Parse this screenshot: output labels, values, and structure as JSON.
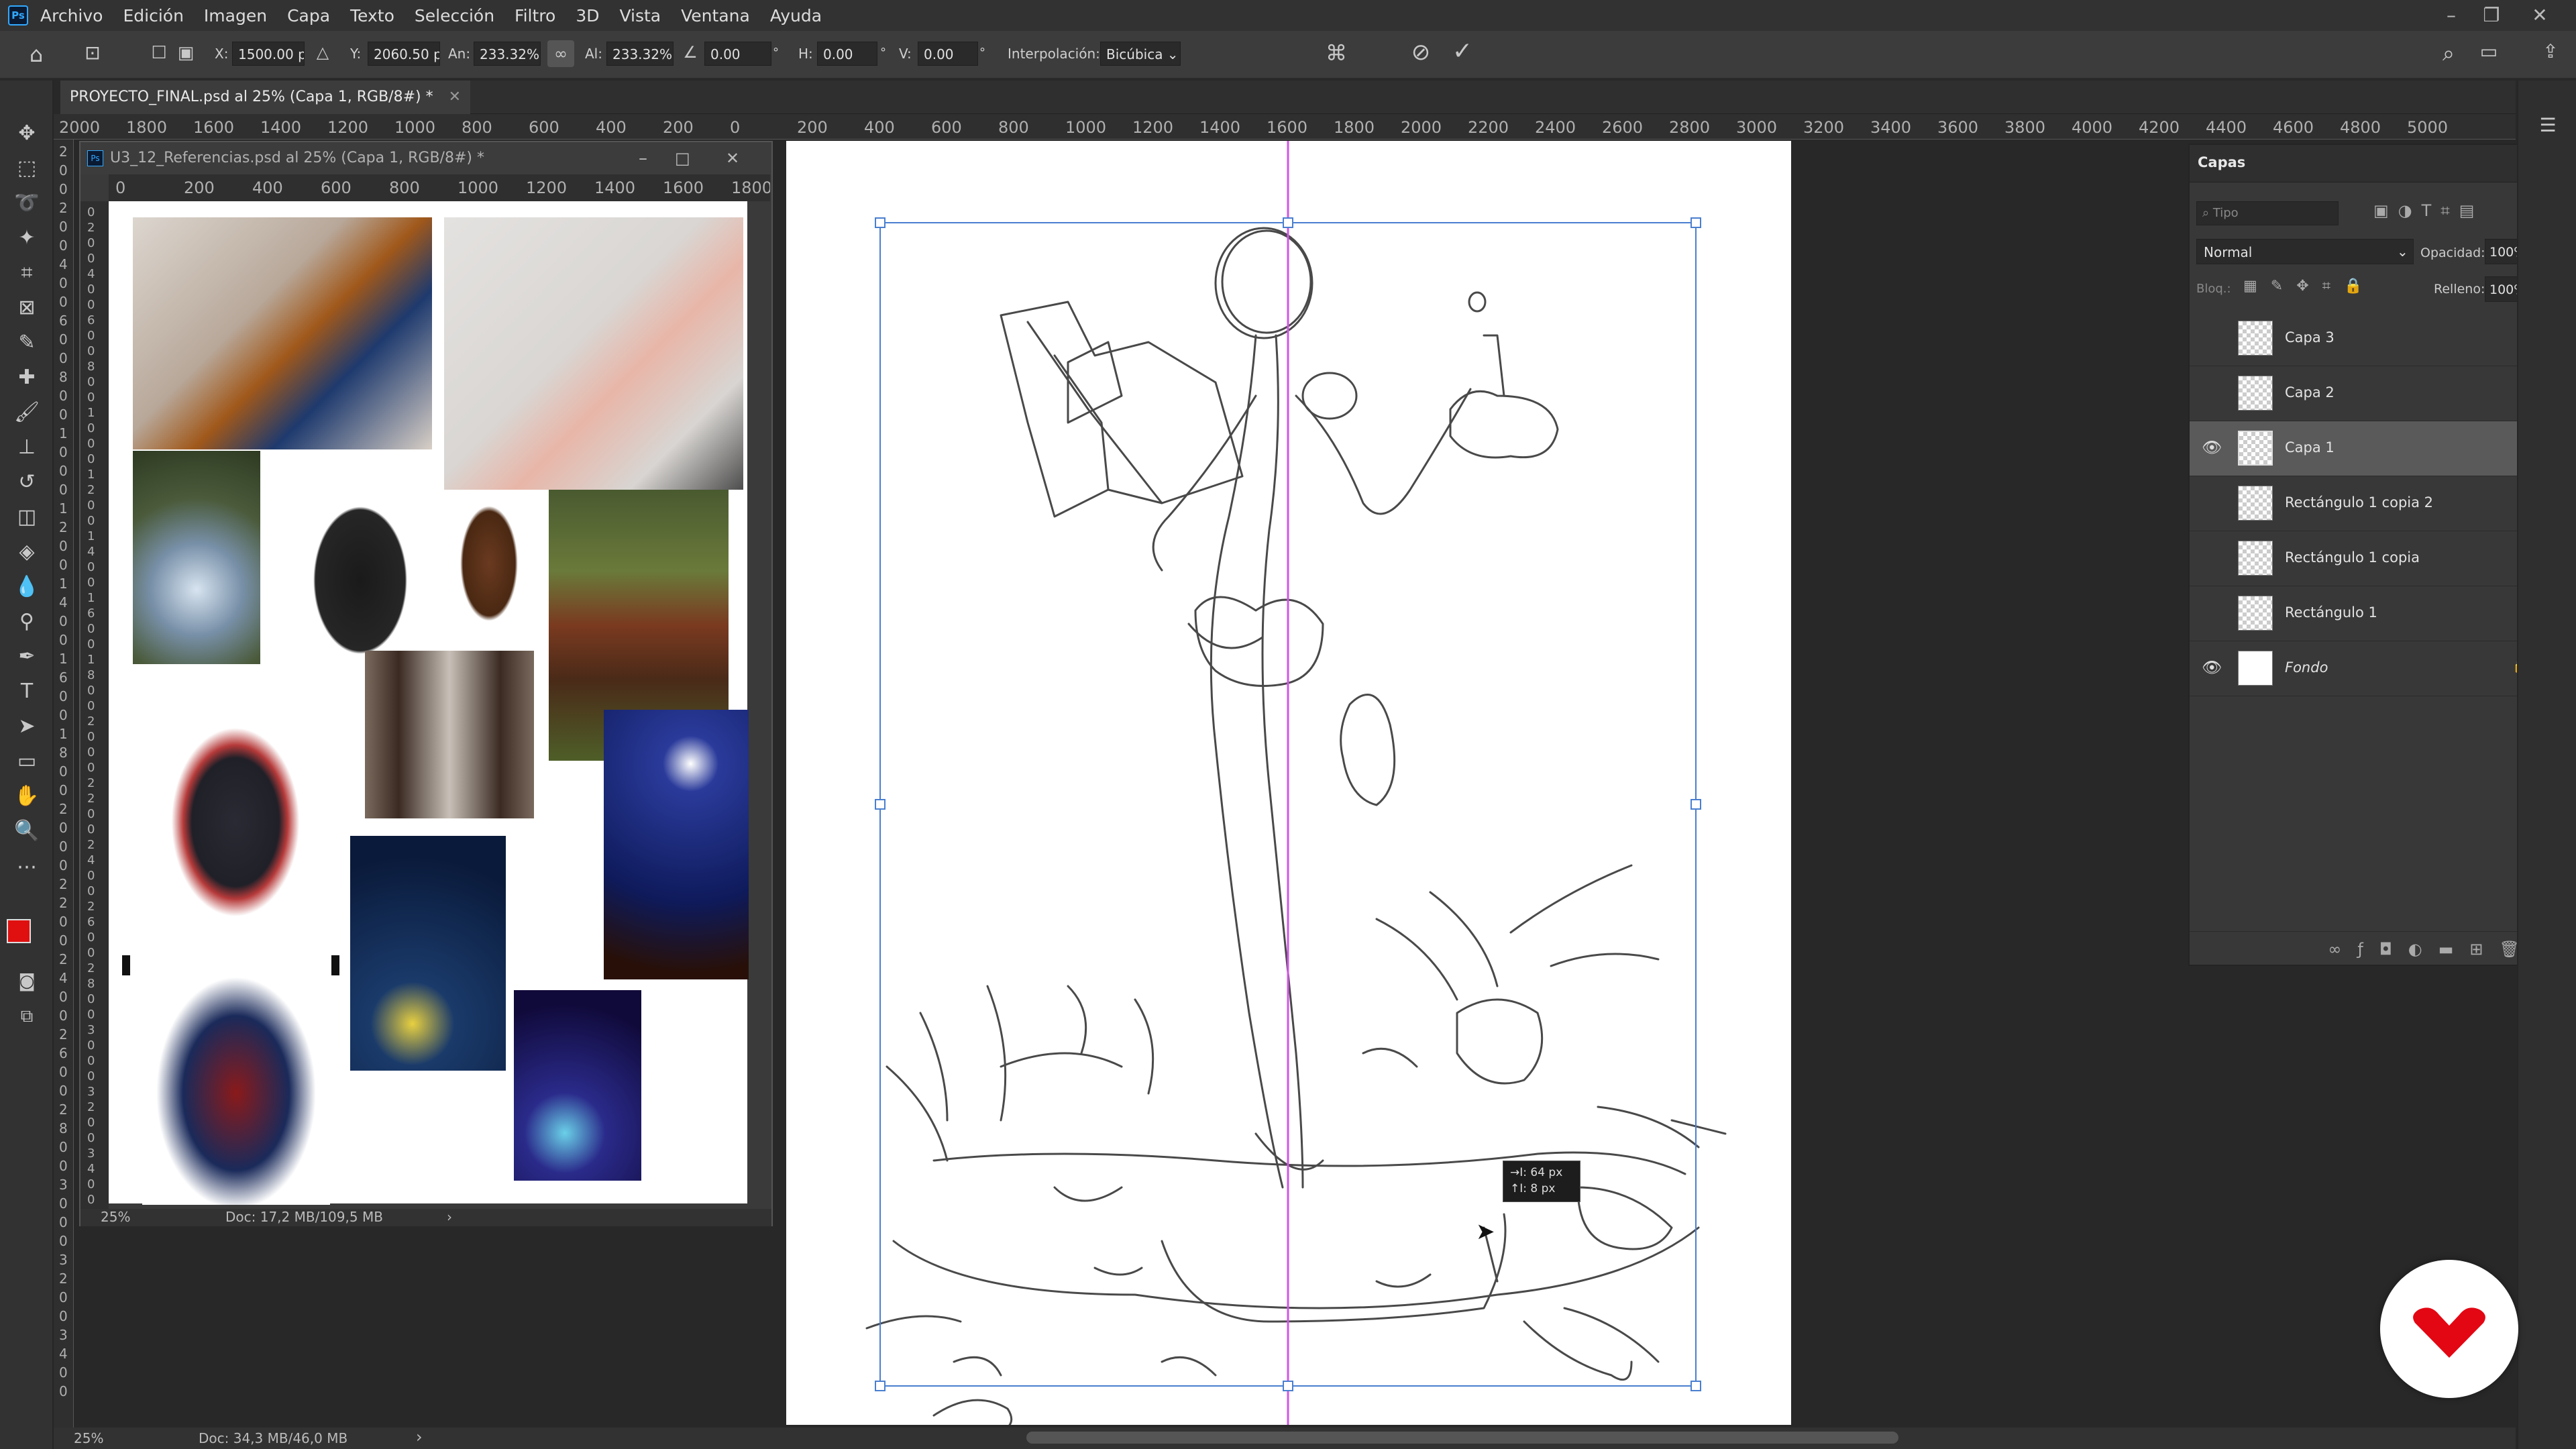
{
  "menu": {
    "app_icon": "Ps",
    "items": [
      "Archivo",
      "Edición",
      "Imagen",
      "Capa",
      "Texto",
      "Selección",
      "Filtro",
      "3D",
      "Vista",
      "Ventana",
      "Ayuda"
    ]
  },
  "options_bar": {
    "x_label": "X:",
    "x_value": "1500.00 p:",
    "y_label": "Y:",
    "y_value": "2060.50 p:",
    "w_label": "An:",
    "w_value": "233.32%",
    "h_label": "Al:",
    "h_value": "233.32%",
    "rotate_value": "0.00",
    "hskew_label": "H:",
    "hskew_value": "0.00",
    "vskew_label": "V:",
    "vskew_value": "0.00",
    "interp_label": "Interpolación:",
    "interp_value": "Bicúbica"
  },
  "document_tab": {
    "title": "PROYECTO_FINAL.psd al 25% (Capa 1, RGB/8#) *"
  },
  "ruler": {
    "h_labels": [
      "2000",
      "1800",
      "1600",
      "1400",
      "1200",
      "1000",
      "800",
      "600",
      "400",
      "200",
      "0",
      "200",
      "400",
      "600",
      "800",
      "1000",
      "1200",
      "1400",
      "1600",
      "1800",
      "2000",
      "2200",
      "2400",
      "2600",
      "2800",
      "3000",
      "3200",
      "3400",
      "3600",
      "3800",
      "4000",
      "4200",
      "4400",
      "4600",
      "4800",
      "5000"
    ],
    "v_labels": [
      "2",
      "0",
      "0",
      "2",
      "0",
      "0",
      "4",
      "0",
      "0",
      "6",
      "0",
      "0",
      "8",
      "0",
      "0",
      "1",
      "0",
      "0",
      "0",
      "1",
      "2",
      "0",
      "0",
      "1",
      "4",
      "0",
      "0",
      "1",
      "6",
      "0",
      "0",
      "1",
      "8",
      "0",
      "0",
      "2",
      "0",
      "0",
      "0",
      "2",
      "2",
      "0",
      "0",
      "2",
      "4",
      "0",
      "0",
      "2",
      "6",
      "0",
      "0",
      "2",
      "8",
      "0",
      "0",
      "3",
      "0",
      "0",
      "0",
      "3",
      "2",
      "0",
      "0",
      "3",
      "4",
      "0",
      "0"
    ]
  },
  "reference_window": {
    "title": "U3_12_Referencias.psd al 25% (Capa 1, RGB/8#) *",
    "ruler_labels": [
      "0",
      "200",
      "400",
      "600",
      "800",
      "1000",
      "1200",
      "1400",
      "1600",
      "1800"
    ],
    "vruler_labels": [
      "0",
      "2",
      "0",
      "0",
      "4",
      "0",
      "0",
      "6",
      "0",
      "0",
      "8",
      "0",
      "0",
      "1",
      "0",
      "0",
      "0",
      "1",
      "2",
      "0",
      "0",
      "1",
      "4",
      "0",
      "0",
      "1",
      "6",
      "0",
      "0",
      "1",
      "8",
      "0",
      "0",
      "2",
      "0",
      "0",
      "0",
      "2",
      "2",
      "0",
      "0",
      "2",
      "4",
      "0",
      "0",
      "2",
      "6",
      "0",
      "0",
      "2",
      "8",
      "0",
      "0",
      "3",
      "0",
      "0",
      "0",
      "3",
      "2",
      "0",
      "0",
      "3",
      "4",
      "0",
      "0"
    ],
    "zoom": "25%",
    "doc_size": "Doc: 17,2 MB/109,5 MB"
  },
  "layers_panel": {
    "tab": "Capas",
    "search_placeholder": "Tipo",
    "blend_mode": "Normal",
    "opacity_label": "Opacidad:",
    "opacity_value": "100%",
    "lock_label": "Bloq.:",
    "fill_label": "Relleno:",
    "fill_value": "100%",
    "layers": [
      {
        "name": "Capa 3",
        "visible": false
      },
      {
        "name": "Capa 2",
        "visible": false
      },
      {
        "name": "Capa 1",
        "visible": true,
        "selected": true
      },
      {
        "name": "Rectángulo 1 copia 2",
        "visible": false
      },
      {
        "name": "Rectángulo 1 copia",
        "visible": false
      },
      {
        "name": "Rectángulo 1",
        "visible": false
      },
      {
        "name": "Fondo",
        "visible": true,
        "locked": true
      }
    ]
  },
  "tooltip": {
    "line1": "→I: 64 px",
    "line2": "↑I: 8 px"
  },
  "status": {
    "zoom": "25%",
    "doc_size": "Doc: 34,3 MB/46,0 MB"
  },
  "colors": {
    "foreground": "#e01010",
    "background": "#111111",
    "accent_guide": "#d455e8",
    "transform_handle": "#4a7fd0",
    "logo_red": "#e30613"
  }
}
